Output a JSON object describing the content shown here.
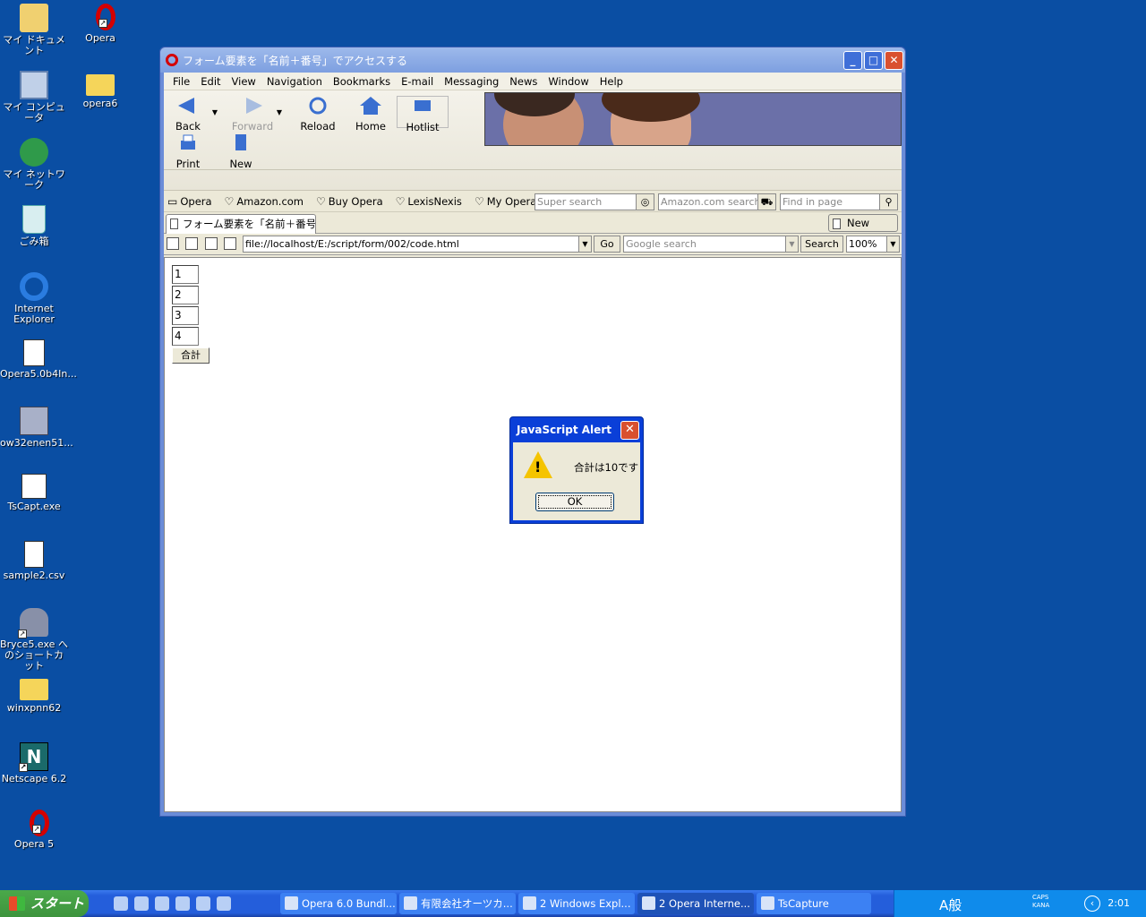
{
  "desktop": {
    "icons": [
      {
        "label": "マイ ドキュメント",
        "icon": "my-documents-icon"
      },
      {
        "label": "Opera",
        "icon": "opera-icon"
      },
      {
        "label": "マイ コンピュータ",
        "icon": "my-computer-icon"
      },
      {
        "label": "opera6",
        "icon": "folder-icon"
      },
      {
        "label": "マイ ネットワーク",
        "icon": "my-network-icon"
      },
      {
        "label": "ごみ箱",
        "icon": "recycle-bin-icon"
      },
      {
        "label": "Internet Explorer",
        "icon": "internet-explorer-icon"
      },
      {
        "label": "Opera5.0b4In...",
        "icon": "installer-icon"
      },
      {
        "label": "ow32enen51...",
        "icon": "setup-icon"
      },
      {
        "label": "TsCapt.exe",
        "icon": "tscapt-icon"
      },
      {
        "label": "sample2.csv",
        "icon": "csv-file-icon"
      },
      {
        "label": "Bryce5.exe へのショートカット",
        "icon": "bryce-icon"
      },
      {
        "label": "winxpnn62",
        "icon": "folder-icon"
      },
      {
        "label": "Netscape 6.2",
        "icon": "netscape-icon"
      },
      {
        "label": "Opera 5",
        "icon": "opera-icon"
      }
    ]
  },
  "window": {
    "title": "フォーム要素を「名前＋番号」でアクセスする",
    "menu": [
      "File",
      "Edit",
      "View",
      "Navigation",
      "Bookmarks",
      "E-mail",
      "Messaging",
      "News",
      "Window",
      "Help"
    ],
    "toolbar": {
      "back": "Back",
      "forward": "Forward",
      "reload": "Reload",
      "home": "Home",
      "hotlist": "Hotlist",
      "print": "Print",
      "new": "New"
    },
    "links": [
      "Opera",
      "Amazon.com",
      "Buy Opera",
      "LexisNexis",
      "My Opera"
    ],
    "super_search_placeholder": "Super search",
    "amazon_search_placeholder": "Amazon.com search",
    "find_placeholder": "Find in page",
    "tab_label": "フォーム要素を「名前＋番号」...",
    "new_page": "New page",
    "address": "file://localhost/E:/script/form/002/code.html",
    "go": "Go",
    "google_placeholder": "Google search",
    "search": "Search",
    "zoom": "100%"
  },
  "page": {
    "inputs": [
      "1",
      "2",
      "3",
      "4"
    ],
    "sum_button": "合計"
  },
  "alert": {
    "title": "JavaScript Alert",
    "message": "合計は10です",
    "ok": "OK"
  },
  "taskbar": {
    "start": "スタート",
    "tasks": [
      "Opera 6.0 Bundl...",
      "有限会社オーツカ...",
      "2 Windows Expl...",
      "2 Opera Interne...",
      "TsCapture"
    ],
    "ime": "A般",
    "caps": "CAPS",
    "kana": "KANA",
    "clock": "2:01"
  }
}
